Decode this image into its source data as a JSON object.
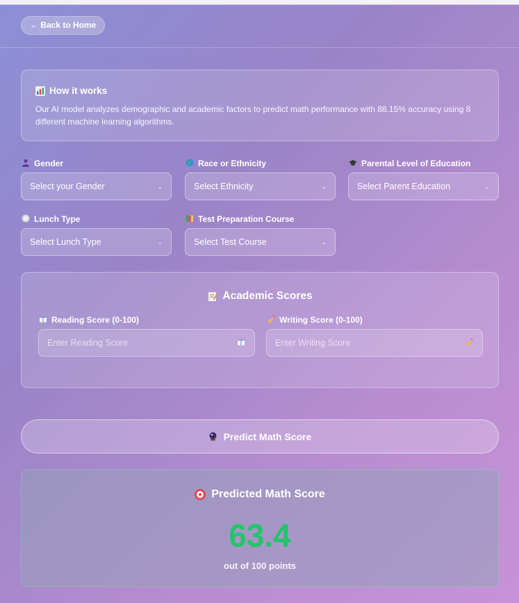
{
  "header": {
    "back_label": "← Back to Home"
  },
  "info": {
    "icon": "chart-icon",
    "title": "How it works",
    "text": "Our AI model analyzes demographic and academic factors to predict math performance with 88.15% accuracy using 8 different machine learning algorithms."
  },
  "form": {
    "gender": {
      "icon": "person-icon",
      "label": "Gender",
      "value": "Select your Gender"
    },
    "ethnicity": {
      "icon": "globe-icon",
      "label": "Race or Ethnicity",
      "value": "Select Ethnicity"
    },
    "parent_education": {
      "icon": "graduation-cap-icon",
      "label": "Parental Level of Education",
      "value": "Select Parent Education"
    },
    "lunch": {
      "icon": "plate-icon",
      "label": "Lunch Type",
      "value": "Select Lunch Type"
    },
    "test_prep": {
      "icon": "books-icon",
      "label": "Test Preparation Course",
      "value": "Select Test Course"
    }
  },
  "scores": {
    "icon": "memo-icon",
    "title": "Academic Scores",
    "reading": {
      "icon": "book-icon",
      "label": "Reading Score (0-100)",
      "placeholder": "Enter Reading Score"
    },
    "writing": {
      "icon": "writing-hand-icon",
      "label": "Writing Score (0-100)",
      "placeholder": "Enter Writing Score"
    }
  },
  "predict": {
    "icon": "crystal-ball-icon",
    "label": "Predict Math Score"
  },
  "result": {
    "icon": "target-icon",
    "title": "Predicted Math Score",
    "value": "63.4",
    "subtitle": "out of 100 points",
    "value_color": "#23c46b"
  }
}
